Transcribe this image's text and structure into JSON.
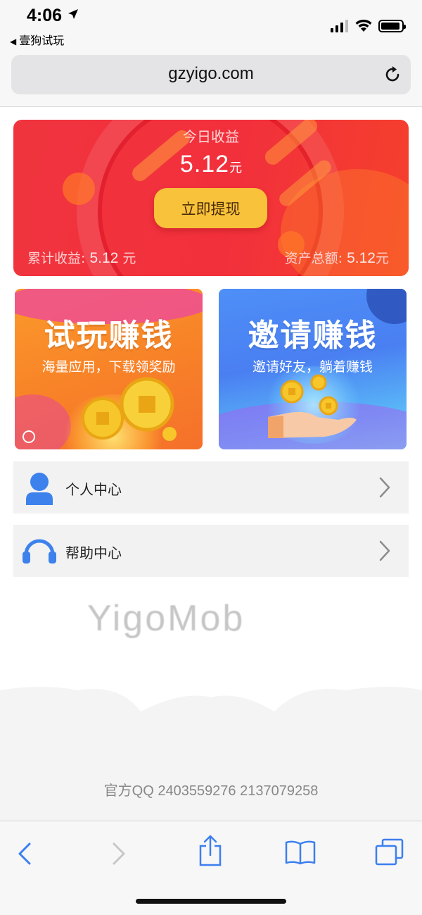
{
  "status_bar": {
    "time": "4:06",
    "back_app": "壹狗试玩"
  },
  "browser": {
    "url": "gzyigo.com"
  },
  "earnings": {
    "title": "今日收益",
    "amount": "5.12",
    "unit": "元",
    "withdraw_label": "立即提现",
    "total_label": "累计收益:",
    "total_value": "5.12",
    "total_unit": "元",
    "assets_label": "资产总额:",
    "assets_value": "5.12",
    "assets_unit": "元"
  },
  "promos": {
    "trial": {
      "title": "试玩赚钱",
      "subtitle": "海量应用，下载领奖励"
    },
    "invite": {
      "title": "邀请赚钱",
      "subtitle": "邀请好友，躺着赚钱"
    }
  },
  "menu": [
    {
      "label": "个人中心",
      "icon": "user-icon"
    },
    {
      "label": "帮助中心",
      "icon": "headset-icon"
    }
  ],
  "watermark": "YigoMob",
  "footer": {
    "qq": "官方QQ 2403559276 2137079258"
  },
  "colors": {
    "card_red": "#f0343e",
    "button_yellow": "#f8c23a",
    "accent_blue": "#3b7ff0"
  }
}
